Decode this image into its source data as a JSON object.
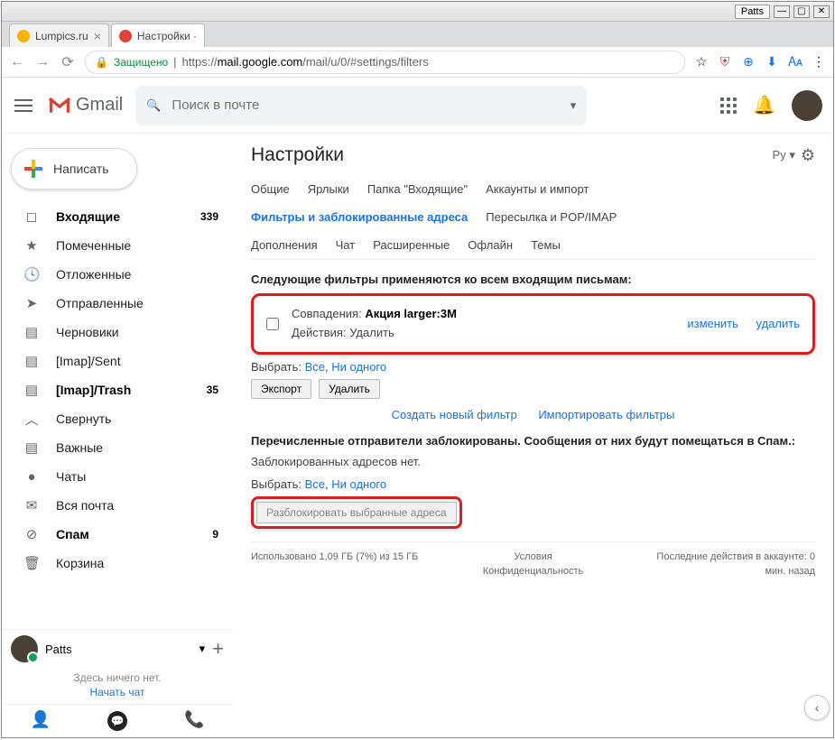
{
  "os": {
    "title": "Patts",
    "min": "—",
    "max": "▢",
    "close": "✕"
  },
  "tabs": [
    {
      "title": "Lumpics.ru",
      "fav_color": "#f5b400",
      "active": false
    },
    {
      "title": "Настройки ·",
      "fav_color": "#db4437",
      "active": true
    }
  ],
  "addr": {
    "secure": "Защищено",
    "url_prefix": "https://",
    "url_host": "mail.google.com",
    "url_path": "/mail/u/0/#settings/filters"
  },
  "ext_icons": {
    "star": "☆",
    "adblock": "⛨",
    "globe": "⊕",
    "dl": "⬇",
    "translate": "🗛",
    "menu": "⋮"
  },
  "header": {
    "brand": "Gmail",
    "search_placeholder": "Поиск в почте",
    "search_dropdown": "▾"
  },
  "compose": "Написать",
  "nav": [
    {
      "icon": "◻",
      "label": "Входящие",
      "count": "339",
      "bold": true
    },
    {
      "icon": "★",
      "label": "Помеченные",
      "count": "",
      "bold": false
    },
    {
      "icon": "🕓",
      "label": "Отложенные",
      "count": "",
      "bold": false
    },
    {
      "icon": "➤",
      "label": "Отправленные",
      "count": "",
      "bold": false
    },
    {
      "icon": "▤",
      "label": "Черновики",
      "count": "",
      "bold": false
    },
    {
      "icon": "▤",
      "label": "[Imap]/Sent",
      "count": "",
      "bold": false
    },
    {
      "icon": "▤",
      "label": "[Imap]/Trash",
      "count": "35",
      "bold": true
    },
    {
      "icon": "︿",
      "label": "Свернуть",
      "count": "",
      "bold": false
    },
    {
      "icon": "▤",
      "label": "Важные",
      "count": "",
      "bold": false
    },
    {
      "icon": "●",
      "label": "Чаты",
      "count": "",
      "bold": false
    },
    {
      "icon": "✉",
      "label": "Вся почта",
      "count": "",
      "bold": false
    },
    {
      "icon": "⊘",
      "label": "Спам",
      "count": "9",
      "bold": true
    },
    {
      "icon": "🗑",
      "label": "Корзина",
      "count": "",
      "bold": false
    }
  ],
  "hangouts": {
    "user": "Patts",
    "caret": "▾",
    "add": "+",
    "empty": "Здесь ничего нет.",
    "start": "Начать чат"
  },
  "main": {
    "title": "Настройки",
    "lang": "Ру",
    "lang_caret": "▾",
    "gear": "⚙",
    "tabs_row1": [
      "Общие",
      "Ярлыки",
      "Папка \"Входящие\"",
      "Аккаунты и импорт"
    ],
    "tabs_row2": [
      "Фильтры и заблокированные адреса",
      "Пересылка и POP/IMAP"
    ],
    "tabs_row2_active": 0,
    "tabs_row3": [
      "Дополнения",
      "Чат",
      "Расширенные",
      "Офлайн",
      "Темы"
    ],
    "filters_heading": "Следующие фильтры применяются ко всем входящим письмам:",
    "filter": {
      "match_label": "Совпадения: ",
      "match_value": "Акция larger:3M",
      "action_label": "Действия: ",
      "action_value": "Удалить",
      "edit": "изменить",
      "delete": "удалить"
    },
    "select_label": "Выбрать: ",
    "select_all": "Все",
    "select_none": "Ни одного",
    "export_btn": "Экспорт",
    "delete_btn": "Удалить",
    "create_filter": "Создать новый фильтр",
    "import_filters": "Импортировать фильтры",
    "blocked_heading": "Перечисленные отправители заблокированы. Сообщения от них будут помещаться в Спам.:",
    "no_blocked": "Заблокированных адресов нет.",
    "unblock_btn": "Разблокировать выбранные адреса"
  },
  "footer": {
    "storage": "Использовано 1,09 ГБ (7%) из 15 ГБ",
    "terms": "Условия",
    "privacy": "Конфиденциальность",
    "activity": "Последние действия в аккаунте: 0 мин. назад"
  },
  "scroll_caret": "‹"
}
